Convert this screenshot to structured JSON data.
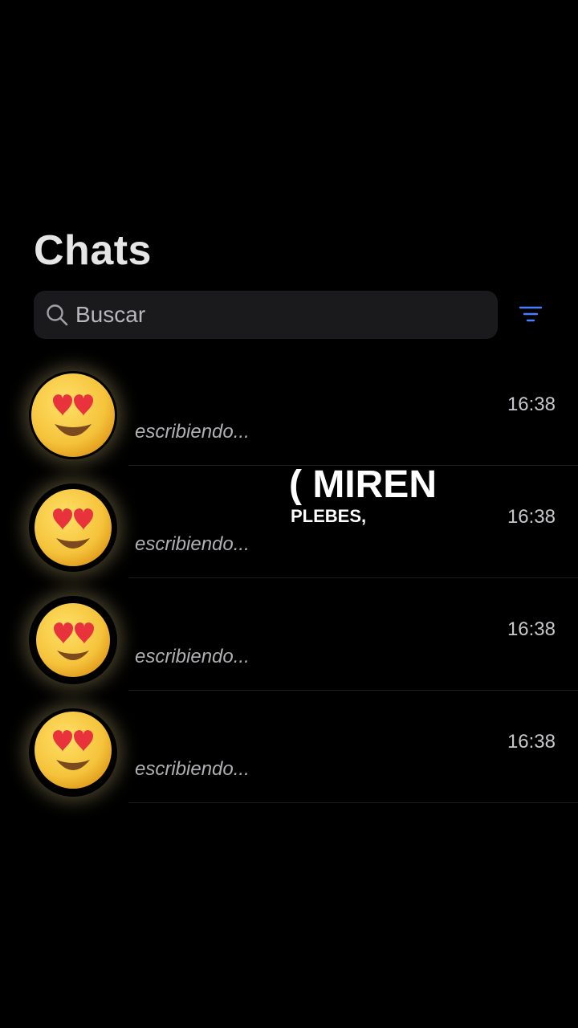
{
  "header": {
    "title": "Chats"
  },
  "search": {
    "placeholder": "Buscar",
    "icon": "search-icon"
  },
  "filter": {
    "icon": "filter-icon",
    "color": "#4a7dff"
  },
  "chats": [
    {
      "avatar": "heart-eyes-emoji",
      "time": "16:38",
      "preview": "escribiendo..."
    },
    {
      "avatar": "heart-eyes-emoji",
      "time": "16:38",
      "preview": "escribiendo..."
    },
    {
      "avatar": "heart-eyes-emoji",
      "time": "16:38",
      "preview": "escribiendo..."
    },
    {
      "avatar": "heart-eyes-emoji",
      "time": "16:38",
      "preview": "escribiendo..."
    }
  ],
  "overlay": {
    "line1": "( MIREN",
    "line2": "PLEBES,"
  },
  "colors": {
    "background": "#000000",
    "search_bg": "#1a1a1c",
    "emoji_yellow": "#f5c33b",
    "heart_red": "#e8323c"
  }
}
